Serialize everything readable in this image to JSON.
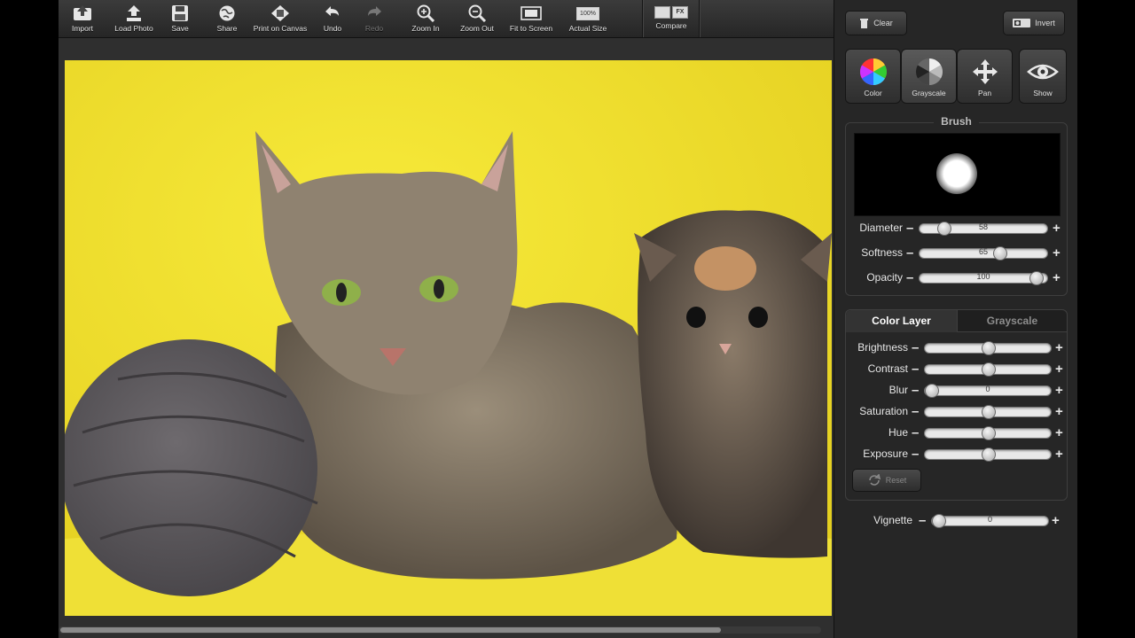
{
  "toolbar": {
    "import": "Import",
    "load_photo": "Load Photo",
    "save": "Save",
    "share": "Share",
    "print_on_canvas": "Print on Canvas",
    "undo": "Undo",
    "redo": "Redo",
    "zoom_in": "Zoom In",
    "zoom_out": "Zoom Out",
    "fit_to_screen": "Fit to Screen",
    "actual_size": "Actual Size",
    "actual_size_badge": "100%",
    "compare": "Compare",
    "compare_badge": "FX"
  },
  "panel": {
    "clear_label": "Clear",
    "invert_label": "Invert",
    "modes": {
      "color": "Color",
      "grayscale": "Grayscale",
      "pan": "Pan",
      "show": "Show"
    },
    "brush": {
      "title": "Brush",
      "diameter": {
        "label": "Diameter",
        "value": "58",
        "fraction": 0.15
      },
      "softness": {
        "label": "Softness",
        "value": "65",
        "fraction": 0.64
      },
      "opacity": {
        "label": "Opacity",
        "value": "100",
        "fraction": 0.95
      }
    },
    "layers": {
      "tab_color": "Color Layer",
      "tab_grayscale": "Grayscale",
      "brightness": {
        "label": "Brightness",
        "value": "50",
        "fraction": 0.5
      },
      "contrast": {
        "label": "Contrast",
        "value": "50",
        "fraction": 0.5
      },
      "blur": {
        "label": "Blur",
        "value": "0",
        "fraction": 0.0
      },
      "saturation": {
        "label": "Saturation",
        "value": "50",
        "fraction": 0.5
      },
      "hue": {
        "label": "Hue",
        "value": "50",
        "fraction": 0.5
      },
      "exposure": {
        "label": "Exposure",
        "value": "50",
        "fraction": 0.5
      },
      "reset_label": "Reset"
    },
    "vignette": {
      "label": "Vignette",
      "value": "0",
      "fraction": 0.0
    },
    "minus": "–",
    "plus": "+"
  }
}
